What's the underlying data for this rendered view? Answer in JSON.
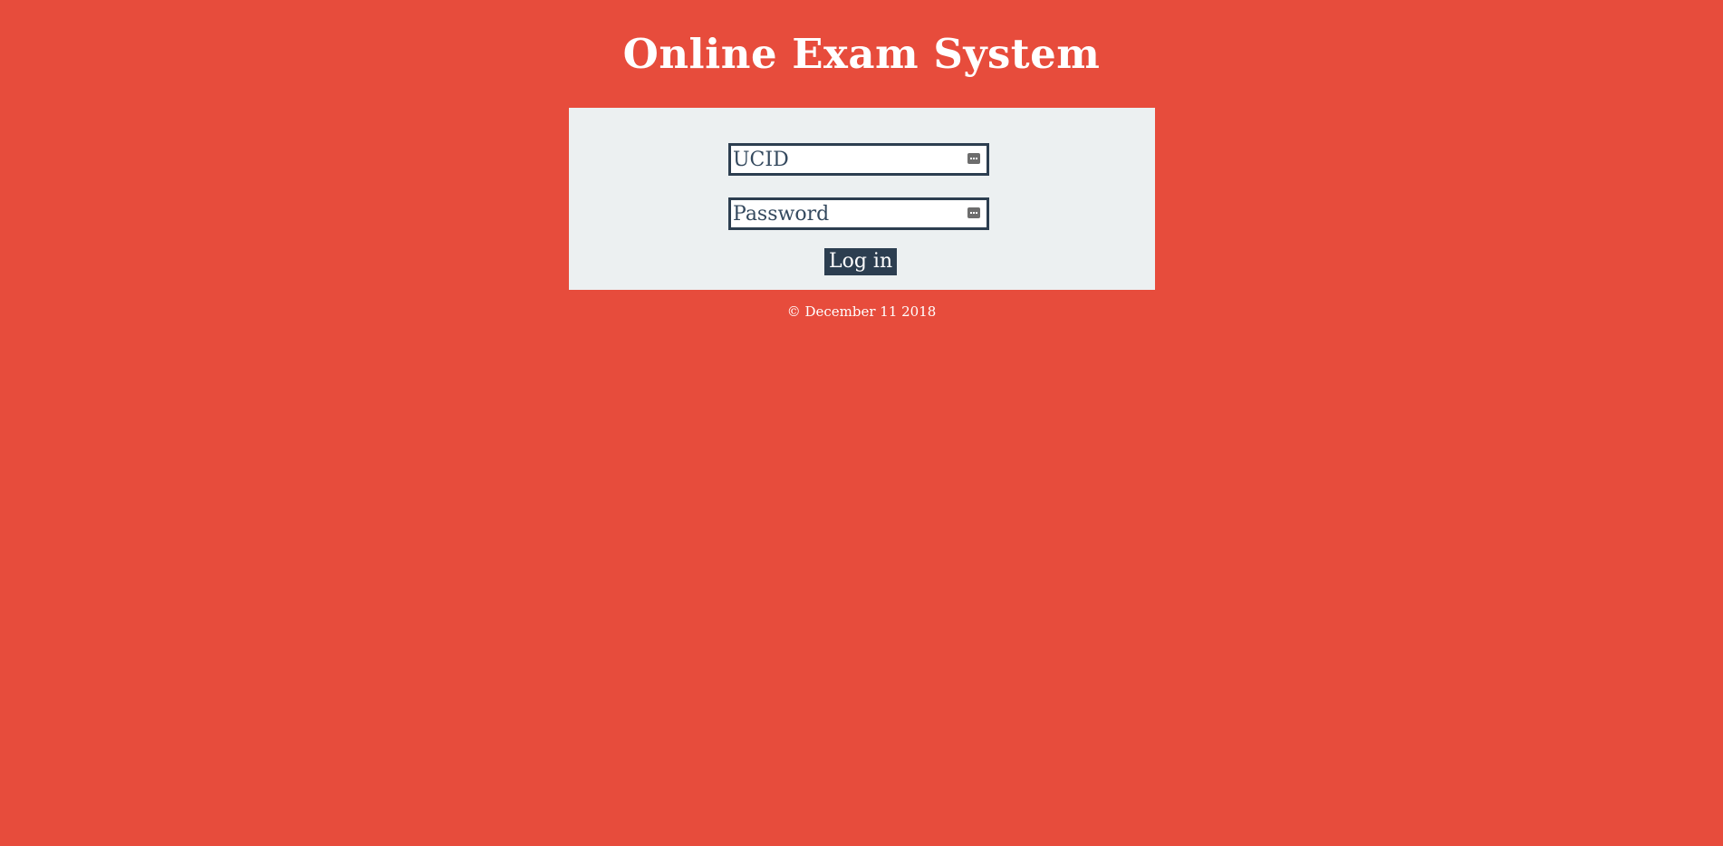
{
  "header": {
    "title": "Online Exam System"
  },
  "login_form": {
    "ucid_placeholder": "UCID",
    "ucid_value": "",
    "password_placeholder": "Password",
    "password_value": "",
    "field_icon": "key-icon",
    "login_label": "Log in"
  },
  "footer": {
    "copyright": "© December 11 2018"
  },
  "colors": {
    "background": "#e74c3c",
    "panel": "#ecf0f1",
    "accent": "#2c3e50",
    "text_on_background": "#ffffff"
  }
}
